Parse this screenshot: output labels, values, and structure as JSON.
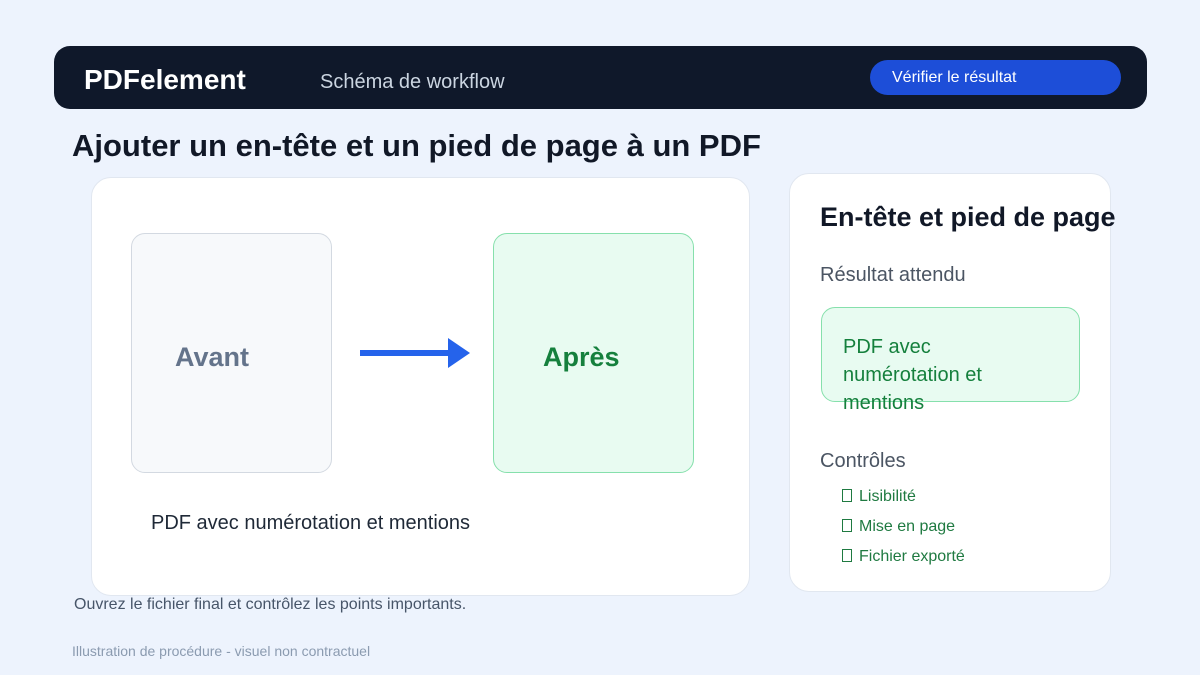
{
  "header": {
    "brand": "PDFelement",
    "subtitle": "Schéma de workflow",
    "verify_button": "Vérifier le résultat"
  },
  "page_title": "Ajouter un en-tête et un pied de page à un PDF",
  "diagram": {
    "before_label": "Avant",
    "after_label": "Après",
    "arrow_icon": "right-arrow-icon",
    "caption": "PDF avec numérotation et mentions"
  },
  "side_panel": {
    "heading": "En-tête et pied de page",
    "expected_label": "Résultat attendu",
    "expected_result": "PDF avec numérotation et mentions",
    "controls_label": "Contrôles",
    "checks": [
      "Lisibilité",
      "Mise en page",
      "Fichier exporté"
    ]
  },
  "footer": {
    "note": "Ouvrez le fichier final et contrôlez les points importants.",
    "disclaimer": "Illustration de procédure - visuel non contractuel"
  },
  "colors": {
    "background": "#edf3fd",
    "topbar": "#0f182a",
    "accent": "#1d4ed8",
    "arrow": "#2563eb",
    "success": "#15803d",
    "success_bg": "#e8fbf1"
  }
}
